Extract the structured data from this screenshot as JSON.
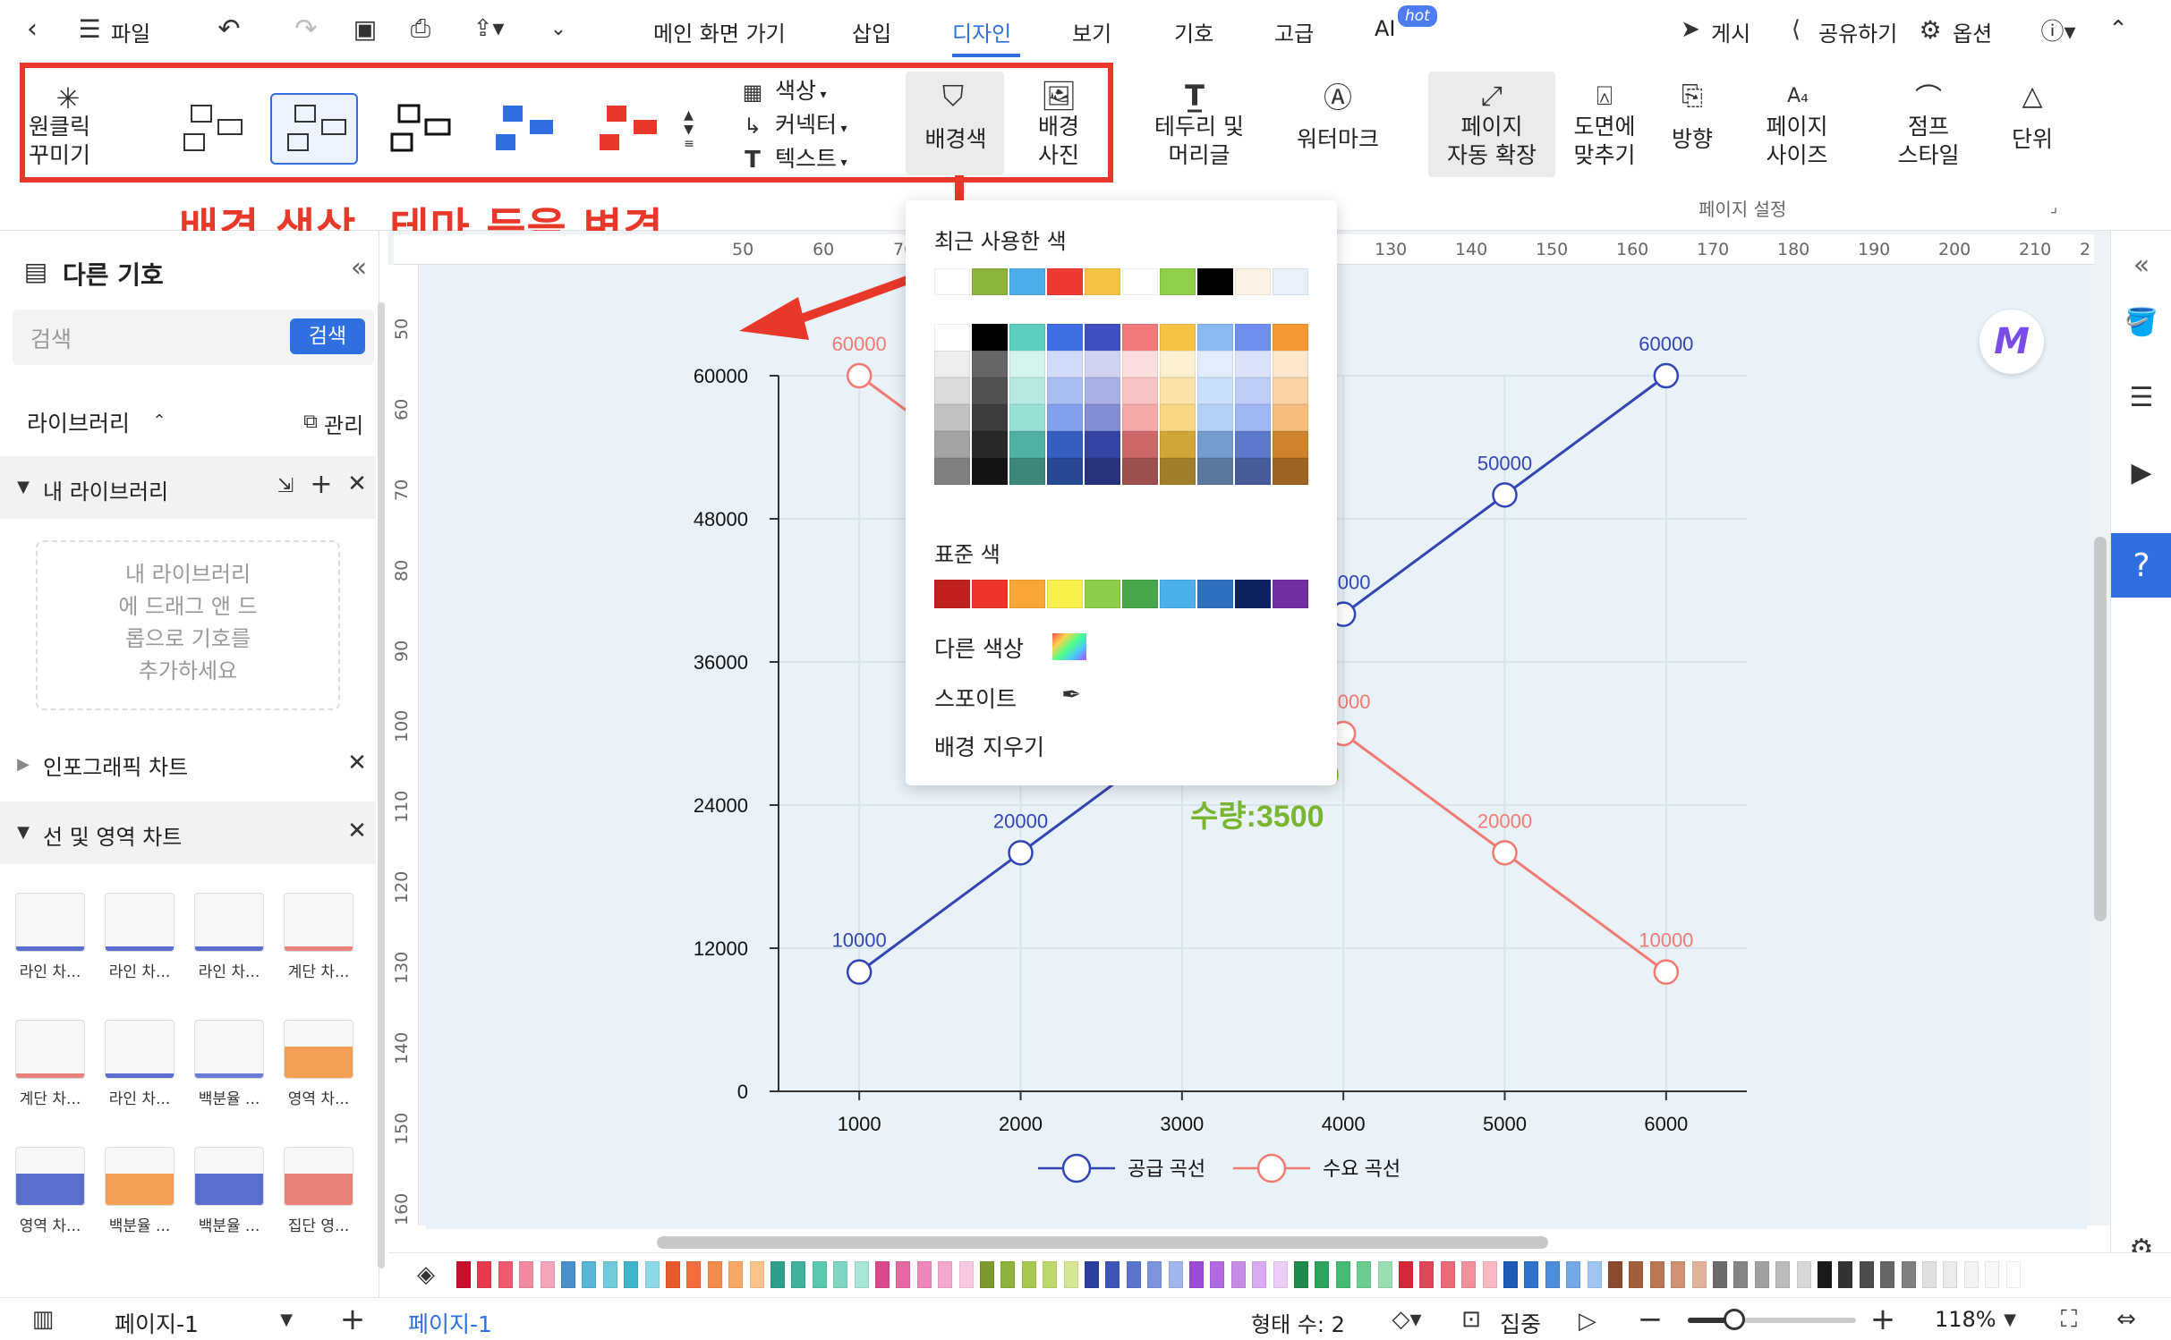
{
  "titlebar": {
    "file": "파일",
    "menus": [
      "메인 화면 가기",
      "삽입",
      "디자인",
      "보기",
      "기호",
      "고급",
      "AI"
    ],
    "ai_badge": "hot",
    "right": {
      "publish": "게시",
      "share": "공유하기",
      "options": "옵션"
    }
  },
  "ribbon": {
    "one_click": "원클릭\n꾸미기",
    "color_label": "색상",
    "connector_label": "커넥터",
    "text_label": "텍스트",
    "bg_color": "배경색",
    "bg_photo": "배경\n사진",
    "border_header": "테두리 및\n머리글",
    "watermark": "워터마크",
    "auto_expand": "페이지\n자동 확장",
    "fit": "도면에\n맞추기",
    "orientation": "방향",
    "page_size": "페이지\n사이즈",
    "jump_style": "점프\n스타일",
    "unit": "단위",
    "page_settings": "페이지 설정"
  },
  "annotation": {
    "text": "배경 색상, 테마 등을 변경",
    "color": "#e8382a"
  },
  "sidebar": {
    "title": "다른 기호",
    "search_placeholder": "검색",
    "search_button": "검색",
    "library": "라이브러리",
    "manage": "관리",
    "my_library": "내 라이브러리",
    "drop_hint": "내 라이브러리\n에 드래그 앤 드\n롭으로 기호를\n추가하세요",
    "infographic": "인포그래픽 차트",
    "line_area": "선 및 영역 차트",
    "items": [
      "라인 차...",
      "라인 차...",
      "라인 차...",
      "계단 차...",
      "계단 차...",
      "라인 차...",
      "백분율 ...",
      "영역 차...",
      "영역 차...",
      "백분율 ...",
      "백분율 ...",
      "집단 영..."
    ]
  },
  "ruler": {
    "top": [
      "50",
      "60",
      "70",
      "130",
      "140",
      "150",
      "160",
      "170",
      "180",
      "190",
      "200",
      "210",
      "2"
    ],
    "left": [
      "50",
      "60",
      "70",
      "80",
      "90",
      "100",
      "110",
      "120",
      "130",
      "140",
      "150",
      "160"
    ]
  },
  "color_popup": {
    "recent_title": "최근 사용한 색",
    "recent": [
      "#ffffff",
      "#8db53c",
      "#4baee8",
      "#ef3a33",
      "#f6c343",
      "#ffffff",
      "#8fcf4a",
      "#000000",
      "#fdf2e3",
      "#e8f1fb"
    ],
    "standard_title": "표준 색",
    "standard": [
      "#c0201f",
      "#ee3529",
      "#f7a533",
      "#f8f04a",
      "#8fcd4d",
      "#46a84a",
      "#4bafe8",
      "#2d70bd",
      "#102160",
      "#7030a0"
    ],
    "more": "다른 색상",
    "eyedropper": "스포이트",
    "clear": "배경 지우기"
  },
  "chart_data": {
    "type": "line",
    "x": [
      1000,
      2000,
      3000,
      4000,
      5000,
      6000
    ],
    "series": [
      {
        "name": "공급 곡선",
        "color": "#3344b3",
        "values": [
          10000,
          20000,
          30000,
          40000,
          50000,
          60000
        ],
        "labels": [
          "10000",
          "20000",
          "",
          "000",
          "50000",
          "60000"
        ]
      },
      {
        "name": "수요 곡선",
        "color": "#f07a72",
        "values": [
          60000,
          50000,
          40000,
          30000,
          20000,
          10000
        ],
        "labels": [
          "60000",
          "",
          "",
          "000",
          "20000",
          "10000"
        ]
      }
    ],
    "yticks": [
      "0",
      "12000",
      "24000",
      "36000",
      "48000",
      "60000"
    ],
    "xticks": [
      "1000",
      "2000",
      "3000",
      "4000",
      "5000",
      "6000"
    ],
    "ylim": [
      0,
      60000
    ],
    "xlim": [
      500,
      6500
    ],
    "grid": true,
    "legend": "bottom",
    "annotation": "수량:3500",
    "annotation_partial": "0",
    "annotation_color": "#79b52f"
  },
  "statusbar": {
    "page_tab": "페이지-1",
    "active_page": "페이지-1",
    "shapes": "형태 수: 2",
    "focus": "집중",
    "zoom": "118%"
  },
  "palette": [
    "#c8102e",
    "#e53b4c",
    "#ef5a6e",
    "#f28ba0",
    "#f4a6b8",
    "#4a90c8",
    "#5ab5d6",
    "#6fcadb",
    "#3fb3c9",
    "#8cd9e8",
    "#e85a2c",
    "#f26d3d",
    "#f58b4c",
    "#f7a866",
    "#f9c48a",
    "#2e9f8a",
    "#3fb39c",
    "#5bc8b0",
    "#7fd6c1",
    "#a8e5d6",
    "#d94a8c",
    "#e568a3",
    "#ee88ba",
    "#f4a8cf",
    "#f9c8e2",
    "#7a9a2e",
    "#8fb23a",
    "#a6c84c",
    "#bdd96a",
    "#d3e890",
    "#2a3f9e",
    "#3d55b8",
    "#5a74cc",
    "#7c94dc",
    "#a1b5ea",
    "#9b4ad6",
    "#b06be0",
    "#c58ce8",
    "#d9acf0",
    "#ebcdf7",
    "#1f8a4c",
    "#2ea35e",
    "#46ba74",
    "#6bcd91",
    "#99dfb3",
    "#d6283a",
    "#e04658",
    "#ea6a79",
    "#f2919c",
    "#f8b9c0",
    "#1e5bb8",
    "#2f72cc",
    "#4d8ddb",
    "#74a9e6",
    "#a0c5f0",
    "#8a4a2e",
    "#a35e3d",
    "#ba7655",
    "#cf9274",
    "#e2b29c",
    "#6b6b6b",
    "#858585",
    "#a0a0a0",
    "#bcbcbc",
    "#d7d7d7",
    "#1a1a1a",
    "#333333",
    "#4d4d4d",
    "#666666",
    "#808080",
    "#e0e0e0",
    "#ebebeb",
    "#f3f3f3",
    "#f8f8f8",
    "#ffffff"
  ]
}
